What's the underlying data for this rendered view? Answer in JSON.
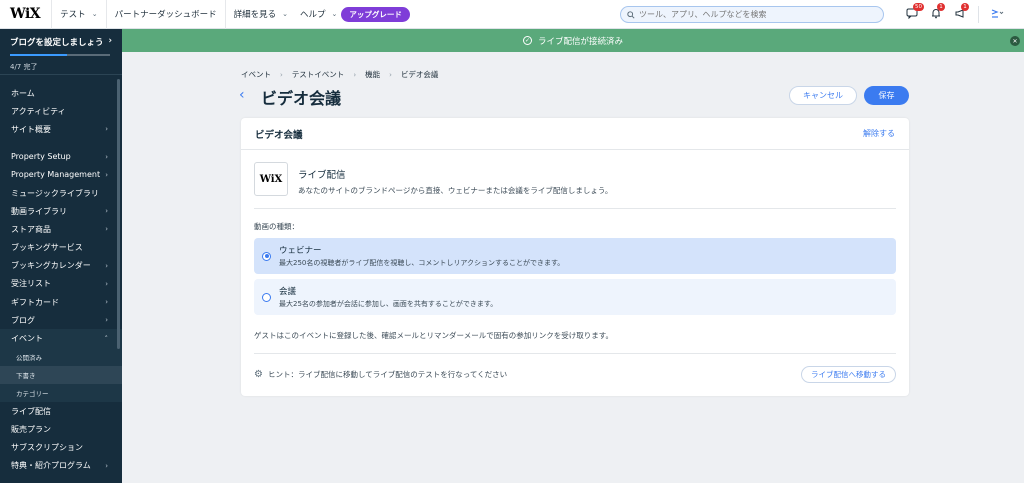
{
  "topbar": {
    "logo": "WiX",
    "site_name": "テスト",
    "nav": [
      "パートナーダッシュボード",
      "詳細を見る",
      "ヘルプ"
    ],
    "upgrade": "アップグレード",
    "search_placeholder": "ツール、アプリ、ヘルプなどを検索",
    "badges": {
      "messages": "50",
      "notifications": "1",
      "announcements": "1"
    }
  },
  "sidebar": {
    "setup_title": "ブログを設定しましょう",
    "setup_progress": "4/7 完了",
    "setup_fraction": 0.57,
    "items": [
      {
        "label": "ホーム"
      },
      {
        "label": "アクティビティ"
      },
      {
        "label": "サイト概要"
      },
      {
        "label": "Property Setup"
      },
      {
        "label": "Property Management"
      },
      {
        "label": "ミュージックライブラリ"
      },
      {
        "label": "動画ライブラリ"
      },
      {
        "label": "ストア商品"
      },
      {
        "label": "ブッキングサービス"
      },
      {
        "label": "ブッキングカレンダー"
      },
      {
        "label": "受注リスト"
      },
      {
        "label": "ギフトカード"
      },
      {
        "label": "ブログ"
      },
      {
        "label": "イベント"
      },
      {
        "label": "公開済み"
      },
      {
        "label": "下書き"
      },
      {
        "label": "カテゴリー"
      },
      {
        "label": "ライブ配信"
      },
      {
        "label": "販売プラン"
      },
      {
        "label": "サブスクリプション"
      },
      {
        "label": "特典・紹介プログラム"
      }
    ]
  },
  "banner": {
    "text": "ライブ配信が接続済み"
  },
  "breadcrumb": [
    "イベント",
    "テストイベント",
    "機能",
    "ビデオ会議"
  ],
  "page": {
    "title": "ビデオ会議",
    "cancel": "キャンセル",
    "save": "保存"
  },
  "card": {
    "title": "ビデオ会議",
    "remove": "解除する",
    "wix_logo": "WiX",
    "live_title": "ライブ配信",
    "live_desc": "あなたのサイトのブランドページから直接、ウェビナーまたは会議をライブ配信しましょう。",
    "type_label": "動画の種類：",
    "options": [
      {
        "title": "ウェビナー",
        "desc": "最大250名の視聴者がライブ配信を視聴し、コメントしリアクションすることができます。"
      },
      {
        "title": "会議",
        "desc": "最大25名の参加者が会話に参加し、画面を共有することができます。"
      }
    ],
    "guest_note": "ゲストはこのイベントに登録した後、確認メールとリマンダーメールで固有の参加リンクを受け取ります。",
    "hint": "ヒント：ライブ配信に移動してライブ配信のテストを行なってください",
    "goto_button": "ライブ配信へ移動する"
  }
}
